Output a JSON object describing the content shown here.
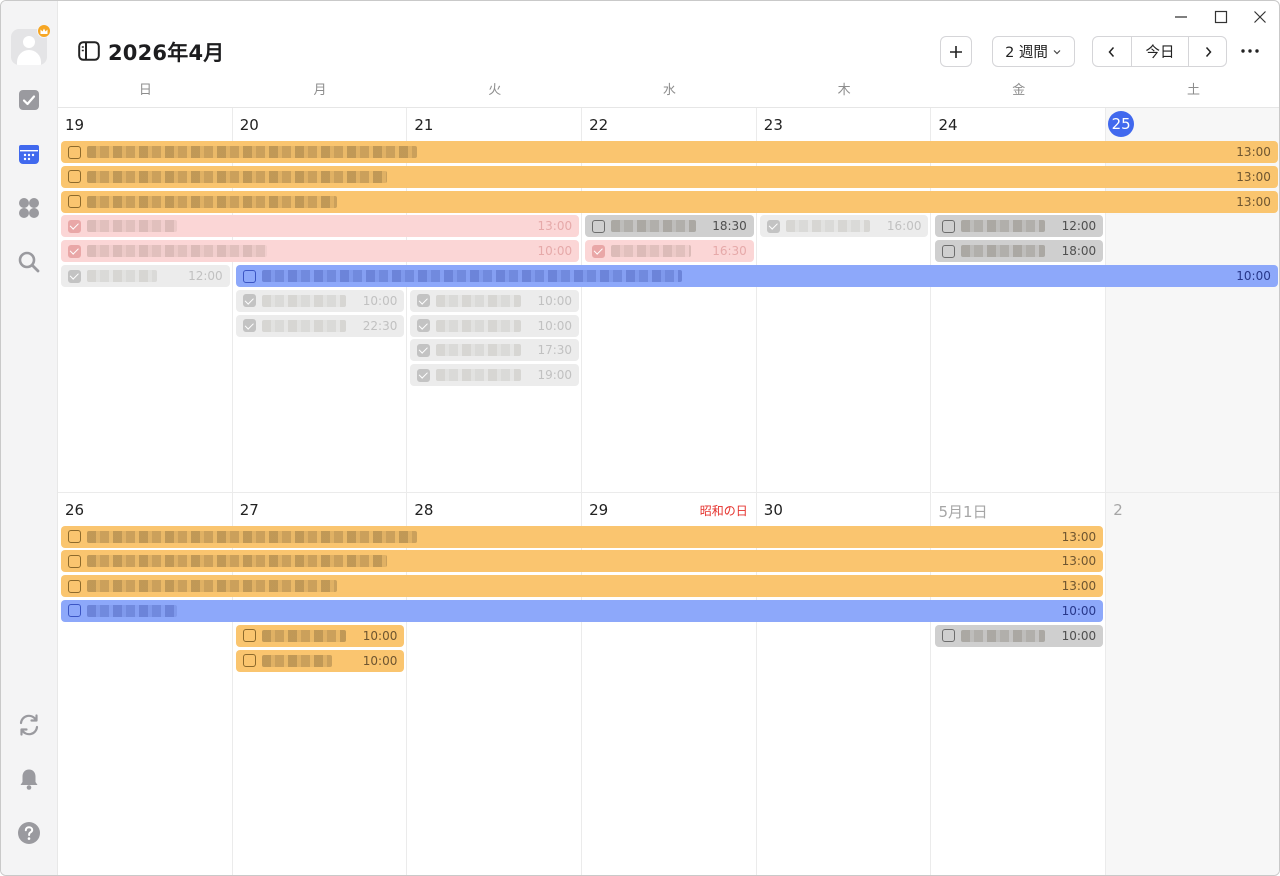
{
  "header": {
    "title": "2026年4月",
    "add_label": "+",
    "view_label": "2 週間",
    "prev_label": "‹",
    "today_label": "今日",
    "next_label": "›",
    "more_label": "···"
  },
  "weekdays": [
    "日",
    "月",
    "火",
    "水",
    "木",
    "金",
    "土"
  ],
  "weeks": [
    {
      "days": [
        {
          "label": "19",
          "holiday": "",
          "other": false,
          "today": false
        },
        {
          "label": "20",
          "holiday": "",
          "other": false,
          "today": false
        },
        {
          "label": "21",
          "holiday": "",
          "other": false,
          "today": false
        },
        {
          "label": "22",
          "holiday": "",
          "other": false,
          "today": false
        },
        {
          "label": "23",
          "holiday": "",
          "other": false,
          "today": false
        },
        {
          "label": "24",
          "holiday": "",
          "other": false,
          "today": false
        },
        {
          "label": "25",
          "holiday": "",
          "other": false,
          "today": true
        }
      ],
      "events": [
        {
          "start": 0,
          "span": 7,
          "slot": 0,
          "color": "yellow",
          "time": "13:00",
          "done": false
        },
        {
          "start": 0,
          "span": 7,
          "slot": 1,
          "color": "yellow",
          "time": "13:00",
          "done": false
        },
        {
          "start": 0,
          "span": 7,
          "slot": 2,
          "color": "yellow",
          "time": "13:00",
          "done": false
        },
        {
          "start": 0,
          "span": 3,
          "slot": 3,
          "color": "pink",
          "time": "13:00",
          "done": true
        },
        {
          "start": 0,
          "span": 3,
          "slot": 4,
          "color": "pink",
          "time": "10:00",
          "done": true
        },
        {
          "start": 0,
          "span": 1,
          "slot": 5,
          "color": "lgray",
          "time": "12:00",
          "done": true
        },
        {
          "start": 1,
          "span": 6,
          "slot": 5,
          "color": "blue",
          "time": "10:00",
          "done": false
        },
        {
          "start": 1,
          "span": 1,
          "slot": 6,
          "color": "lgray",
          "time": "10:00",
          "done": true
        },
        {
          "start": 1,
          "span": 1,
          "slot": 7,
          "color": "lgray",
          "time": "22:30",
          "done": true
        },
        {
          "start": 2,
          "span": 1,
          "slot": 6,
          "color": "lgray",
          "time": "10:00",
          "done": true
        },
        {
          "start": 2,
          "span": 1,
          "slot": 7,
          "color": "lgray",
          "time": "10:00",
          "done": true
        },
        {
          "start": 2,
          "span": 1,
          "slot": 8,
          "color": "lgray",
          "time": "17:30",
          "done": true
        },
        {
          "start": 2,
          "span": 1,
          "slot": 9,
          "color": "lgray",
          "time": "19:00",
          "done": true
        },
        {
          "start": 3,
          "span": 1,
          "slot": 3,
          "color": "dgray",
          "time": "18:30",
          "done": false
        },
        {
          "start": 3,
          "span": 1,
          "slot": 4,
          "color": "pink",
          "time": "16:30",
          "done": true
        },
        {
          "start": 4,
          "span": 1,
          "slot": 3,
          "color": "lgray",
          "time": "16:00",
          "done": true
        },
        {
          "start": 5,
          "span": 1,
          "slot": 3,
          "color": "dgray",
          "time": "12:00",
          "done": false
        },
        {
          "start": 5,
          "span": 1,
          "slot": 4,
          "color": "dgray",
          "time": "18:00",
          "done": false
        }
      ]
    },
    {
      "days": [
        {
          "label": "26",
          "holiday": "",
          "other": false,
          "today": false
        },
        {
          "label": "27",
          "holiday": "",
          "other": false,
          "today": false
        },
        {
          "label": "28",
          "holiday": "",
          "other": false,
          "today": false
        },
        {
          "label": "29",
          "holiday": "昭和の日",
          "other": false,
          "today": false
        },
        {
          "label": "30",
          "holiday": "",
          "other": false,
          "today": false
        },
        {
          "label": "5月1日",
          "holiday": "",
          "other": true,
          "today": false
        },
        {
          "label": "2",
          "holiday": "",
          "other": true,
          "today": false
        }
      ],
      "events": [
        {
          "start": 0,
          "span": 6,
          "slot": 0,
          "color": "yellow",
          "time": "13:00",
          "done": false
        },
        {
          "start": 0,
          "span": 6,
          "slot": 1,
          "color": "yellow",
          "time": "13:00",
          "done": false
        },
        {
          "start": 0,
          "span": 6,
          "slot": 2,
          "color": "yellow",
          "time": "13:00",
          "done": false
        },
        {
          "start": 0,
          "span": 6,
          "slot": 3,
          "color": "blue",
          "time": "10:00",
          "done": false
        },
        {
          "start": 1,
          "span": 1,
          "slot": 4,
          "color": "yellow",
          "time": "10:00",
          "done": false
        },
        {
          "start": 1,
          "span": 1,
          "slot": 5,
          "color": "yellow",
          "time": "10:00",
          "done": false
        },
        {
          "start": 5,
          "span": 1,
          "slot": 4,
          "color": "dgray",
          "time": "10:00",
          "done": false
        }
      ]
    }
  ]
}
